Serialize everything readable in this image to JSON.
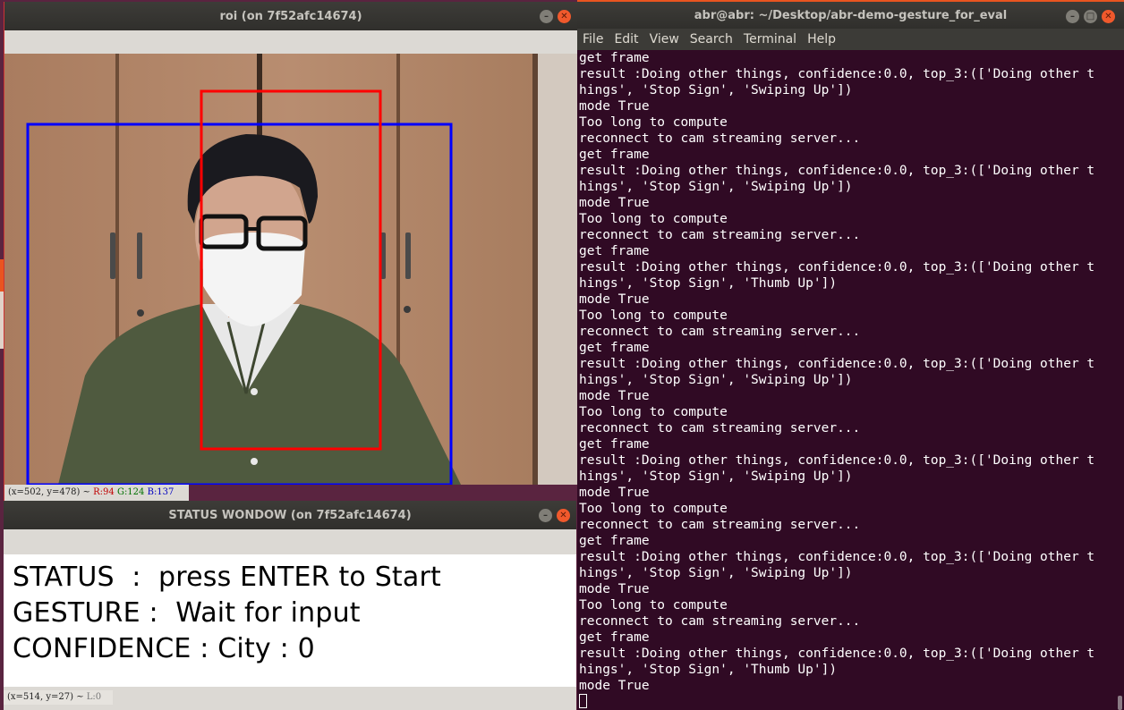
{
  "roi_window": {
    "title": "roi (on 7f52afc14674)",
    "status_pos": "(x=502, y=478) ~",
    "status_r": "R:94",
    "status_g": "G:124",
    "status_b": "B:137"
  },
  "status_window": {
    "title": "STATUS WONDOW (on 7f52afc14674)",
    "status_line": "STATUS  :  press ENTER to Start",
    "gesture_line": "GESTURE :  Wait for input",
    "confidence_line": "CONFIDENCE : City : 0",
    "status_pos": "(x=514, y=27) ~",
    "status_l": "L:0"
  },
  "terminal": {
    "title": "abr@abr: ~/Desktop/abr-demo-gesture_for_eval",
    "menu": [
      "File",
      "Edit",
      "View",
      "Search",
      "Terminal",
      "Help"
    ],
    "lines": [
      "get frame",
      "result :Doing other things, confidence:0.0, top_3:(['Doing other t",
      "hings', 'Stop Sign', 'Swiping Up'])",
      "mode True",
      "Too long to compute",
      "reconnect to cam streaming server...",
      "get frame",
      "result :Doing other things, confidence:0.0, top_3:(['Doing other t",
      "hings', 'Stop Sign', 'Swiping Up'])",
      "mode True",
      "Too long to compute",
      "reconnect to cam streaming server...",
      "get frame",
      "result :Doing other things, confidence:0.0, top_3:(['Doing other t",
      "hings', 'Stop Sign', 'Thumb Up'])",
      "mode True",
      "Too long to compute",
      "reconnect to cam streaming server...",
      "get frame",
      "result :Doing other things, confidence:0.0, top_3:(['Doing other t",
      "hings', 'Stop Sign', 'Swiping Up'])",
      "mode True",
      "Too long to compute",
      "reconnect to cam streaming server...",
      "get frame",
      "result :Doing other things, confidence:0.0, top_3:(['Doing other t",
      "hings', 'Stop Sign', 'Swiping Up'])",
      "mode True",
      "Too long to compute",
      "reconnect to cam streaming server...",
      "get frame",
      "result :Doing other things, confidence:0.0, top_3:(['Doing other t",
      "hings', 'Stop Sign', 'Swiping Up'])",
      "mode True",
      "Too long to compute",
      "reconnect to cam streaming server...",
      "get frame",
      "result :Doing other things, confidence:0.0, top_3:(['Doing other t",
      "hings', 'Stop Sign', 'Thumb Up'])",
      "mode True"
    ]
  },
  "colors": {
    "terminal_bg": "#300a24",
    "red_box": "#ff0000",
    "blue_box": "#0000ff"
  }
}
